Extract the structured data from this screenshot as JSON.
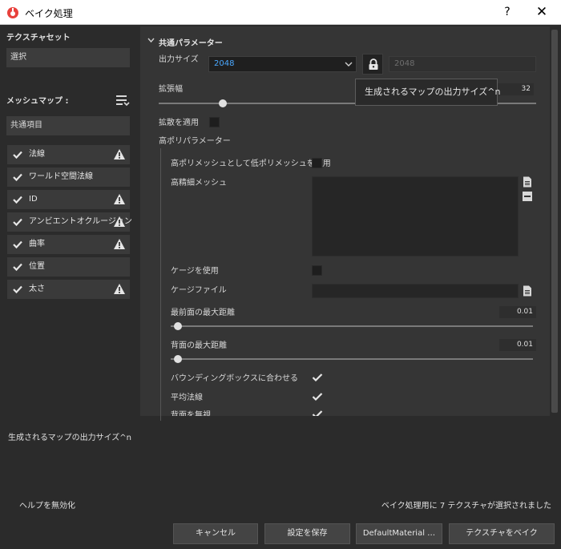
{
  "window": {
    "title": "ベイク処理",
    "help": "?",
    "close": "✕"
  },
  "left": {
    "texture_set_title": "テクスチャセット",
    "texture_set_value": "選択",
    "mesh_map_title": "メッシュマップ :",
    "common_item": "共通項目",
    "maps": [
      {
        "label": "法線",
        "checked": true,
        "warning": true
      },
      {
        "label": "ワールド空間法線",
        "checked": true,
        "warning": false
      },
      {
        "label": "ID",
        "checked": true,
        "warning": true
      },
      {
        "label": "アンビエントオクルージョン",
        "checked": true,
        "warning": true
      },
      {
        "label": "曲率",
        "checked": true,
        "warning": true
      },
      {
        "label": "位置",
        "checked": true,
        "warning": false
      },
      {
        "label": "太さ",
        "checked": true,
        "warning": true
      }
    ]
  },
  "params": {
    "section_title": "共通パラメーター",
    "output_size_label": "出力サイズ",
    "output_size_value": "2048",
    "output_size_locked_value": "2048",
    "tooltip": "生成されるマップの出力サイズ^n",
    "dilation_label": "拡張幅",
    "dilation_value": "32",
    "dilation_fraction": 0.17,
    "apply_diffusion_label": "拡散を適用",
    "high_poly_title": "高ポリパラメーター",
    "use_low_as_high_label": "高ポリメッシュとして低ポリメッシュを使用",
    "high_def_mesh_label": "高精細メッシュ",
    "use_cage_label": "ケージを使用",
    "cage_file_label": "ケージファイル",
    "max_frontal_label": "最前面の最大距離",
    "max_frontal_value": "0.01",
    "max_rear_label": "背面の最大距離",
    "max_rear_value": "0.01",
    "match_bbox_label": "バウンディングボックスに合わせる",
    "average_normals_label": "平均法線",
    "ignore_backface_label": "背面を無視"
  },
  "help_text": "生成されるマップの出力サイズ^n",
  "footer": {
    "disable_help": "ヘルプを無効化",
    "status": "ベイク処理用に 7 テクスチャが選択されました",
    "cancel": "キャンセル",
    "save_settings": "設定を保存",
    "material": "DefaultMaterial …",
    "bake": "テクスチャをベイク"
  },
  "colors": {
    "accent_value": "#4aa8ff",
    "panel": "#353535",
    "background": "#2b2b2b"
  }
}
